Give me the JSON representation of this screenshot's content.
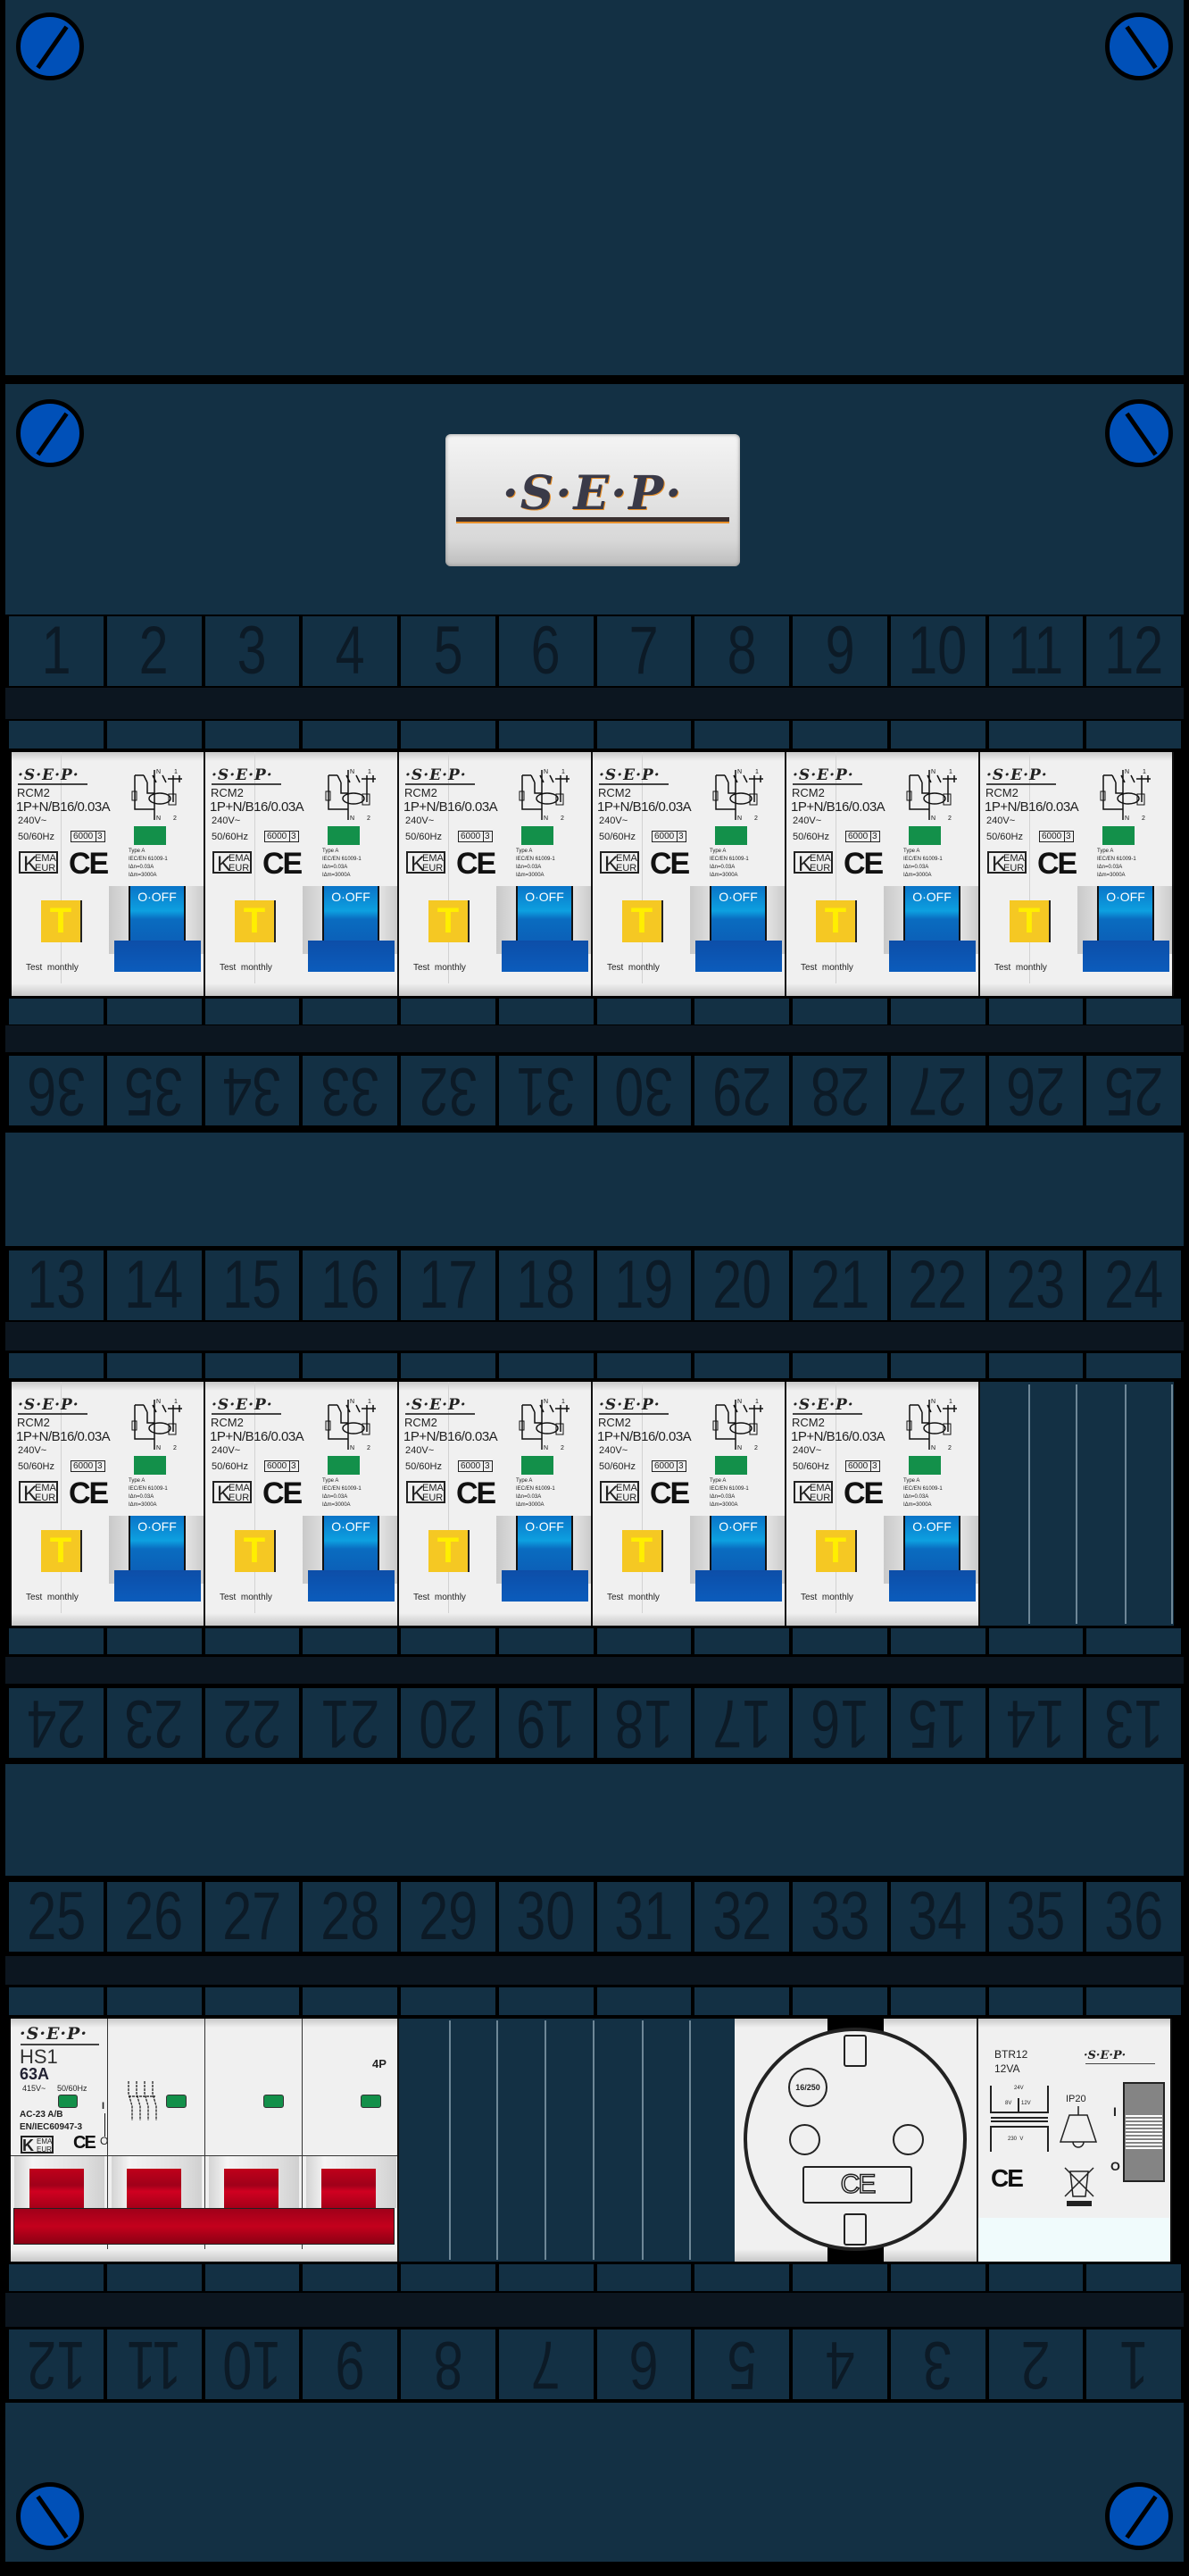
{
  "brand": "·S·E·P·",
  "number_rows": [
    {
      "labels": [
        "1",
        "2",
        "3",
        "4",
        "5",
        "6",
        "7",
        "8",
        "9",
        "10",
        "11",
        "12"
      ],
      "inverted": false
    },
    {
      "labels": [
        "36",
        "35",
        "34",
        "33",
        "32",
        "31",
        "30",
        "29",
        "28",
        "27",
        "26",
        "25"
      ],
      "inverted": true
    },
    {
      "labels": [
        "13",
        "14",
        "15",
        "16",
        "17",
        "18",
        "19",
        "20",
        "21",
        "22",
        "23",
        "24"
      ],
      "inverted": false
    },
    {
      "labels": [
        "24",
        "23",
        "22",
        "21",
        "20",
        "19",
        "18",
        "17",
        "16",
        "15",
        "14",
        "13"
      ],
      "inverted": true
    },
    {
      "labels": [
        "25",
        "26",
        "27",
        "28",
        "29",
        "30",
        "31",
        "32",
        "33",
        "34",
        "35",
        "36"
      ],
      "inverted": false
    },
    {
      "labels": [
        "12",
        "11",
        "10",
        "9",
        "8",
        "7",
        "6",
        "5",
        "4",
        "3",
        "2",
        "1"
      ],
      "inverted": true
    }
  ],
  "rcm": {
    "brand": "·S·E·P·",
    "model": "RCM2",
    "rating": "1P+N/B16/0.03A",
    "voltage": "240V~",
    "frequency": "50/60Hz",
    "breaking": "6000",
    "class": "3",
    "kema_k": "K",
    "kema_top": "EMA",
    "kema_bottom": "EUR",
    "ce": "CE",
    "type": "Type A",
    "standard": "IEC/EN 61009-1",
    "idn": "IΔn=0.03A",
    "idm": "IΔm=3000A",
    "test_label": "T",
    "test_text": "Test  monthly",
    "switch_label": "O·OFF",
    "diagram_n": "N",
    "diagram_1": "1",
    "diagram_2": "2"
  },
  "module_rows": [
    {
      "rcm_count": 6
    },
    {
      "rcm_count": 5
    }
  ],
  "hs1": {
    "brand": "·S·E·P·",
    "model": "HS1",
    "current": "63A",
    "voltage": "415V~",
    "frequency": "50/60Hz",
    "category": "AC-23 A/B",
    "standard": "EN/IEC60947-3",
    "kema_k": "K",
    "kema_top": "EMA",
    "kema_bottom": "EUR",
    "ce": "CE",
    "poles": "4P",
    "on": "I",
    "off": "O"
  },
  "socket": {
    "rating": "16/250",
    "ce": "CE"
  },
  "transformer": {
    "brand": "·S·E·P·",
    "model": "BTR12",
    "power": "12VA",
    "v24": "24V",
    "v8": "8V",
    "v12": "12V",
    "v230": "230  V",
    "ip": "IP20",
    "ce": "CE",
    "on": "I",
    "off": "O"
  },
  "colors": {
    "panel": "#133044",
    "strip": "#0c1620",
    "screw": "#0050b8",
    "switch_blue": "#0a74c8",
    "test_yellow": "#f5c823",
    "main_switch_red": "#c0001a",
    "indicator_green": "#13904a"
  }
}
